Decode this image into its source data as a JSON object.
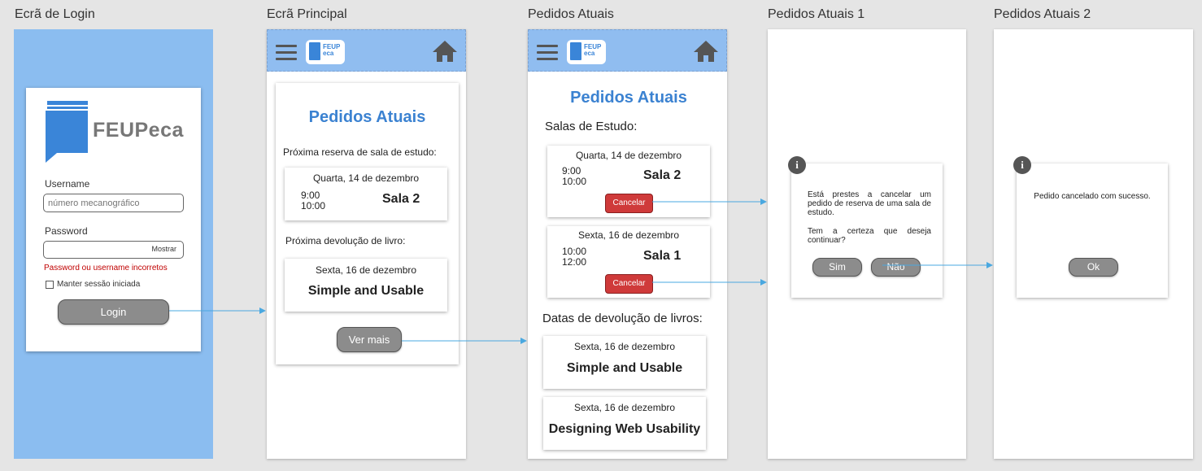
{
  "titles": {
    "login": "Ecrã de Login",
    "main": "Ecrã Principal",
    "current": "Pedidos Atuais",
    "current1": "Pedidos Atuais 1",
    "current2": "Pedidos Atuais 2"
  },
  "login": {
    "logo_text": "FEUPeca",
    "username_label": "Username",
    "username_placeholder": "número mecanográfico",
    "password_label": "Password",
    "show_label": "Mostrar",
    "error": "Password ou username incorretos",
    "keep_session": "Manter sessão iniciada",
    "login_button": "Login"
  },
  "appbar": {
    "logo_line1": "FEUP",
    "logo_line2": "eca"
  },
  "main": {
    "heading": "Pedidos Atuais",
    "next_room_label": "Próxima reserva de sala de estudo:",
    "room": {
      "date": "Quarta, 14 de dezembro",
      "start": "9:00",
      "end": "10:00",
      "name": "Sala 2"
    },
    "next_return_label": "Próxima devolução de livro:",
    "book": {
      "date": "Sexta, 16 de dezembro",
      "title": "Simple and Usable"
    },
    "more_button": "Ver mais"
  },
  "current": {
    "heading": "Pedidos Atuais",
    "rooms_label": "Salas de Estudo:",
    "rooms": [
      {
        "date": "Quarta, 14 de dezembro",
        "start": "9:00",
        "end": "10:00",
        "name": "Sala 2",
        "cancel": "Cancelar"
      },
      {
        "date": "Sexta, 16 de dezembro",
        "start": "10:00",
        "end": "12:00",
        "name": "Sala 1",
        "cancel": "Cancelar"
      }
    ],
    "books_label": "Datas de devolução de livros:",
    "books": [
      {
        "date": "Sexta, 16 de dezembro",
        "title": "Simple and Usable"
      },
      {
        "date": "Sexta, 16 de dezembro",
        "title": "Designing Web Usability"
      }
    ]
  },
  "dialog1": {
    "line1": "Está prestes a cancelar um pedido de reserva de uma sala de estudo.",
    "line2": "Tem a certeza que deseja continuar?",
    "yes": "Sim",
    "no": "Não"
  },
  "dialog2": {
    "message": "Pedido cancelado com sucesso.",
    "ok": "Ok"
  },
  "colors": {
    "accent": "#3b82d1",
    "appbar": "#90bdf0",
    "danger": "#cf3a3a",
    "error_text": "#c00000"
  },
  "icons": [
    "menu-icon",
    "home-icon",
    "book-logo-icon",
    "info-icon",
    "checkbox-icon"
  ]
}
